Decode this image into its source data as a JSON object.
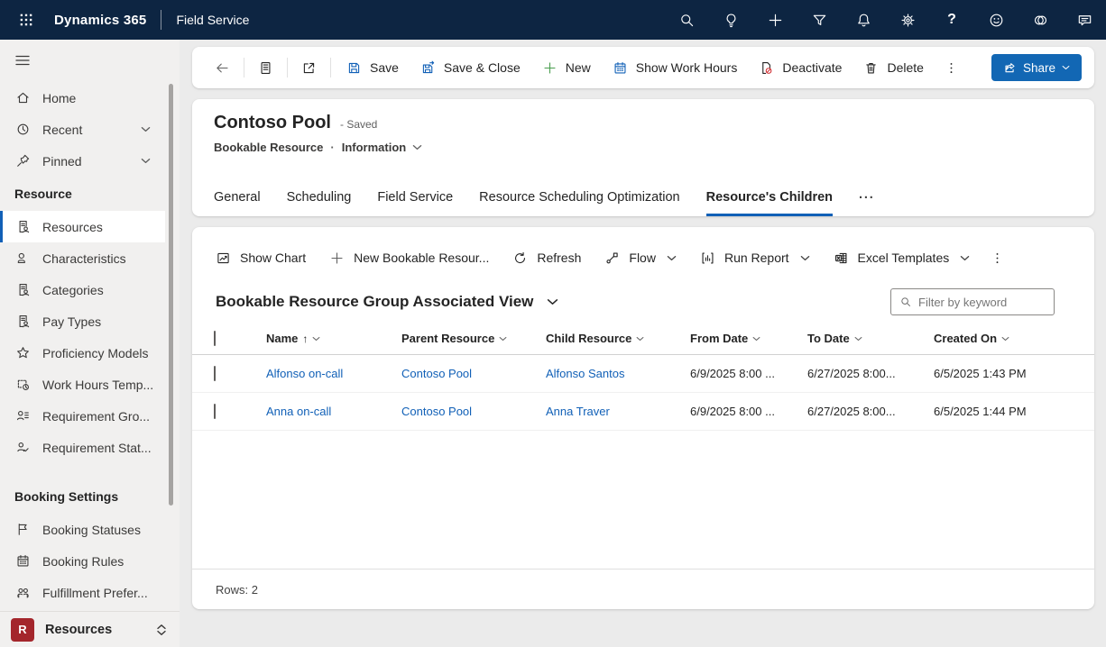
{
  "colors": {
    "topbar_bg": "#0d2542",
    "accent_blue": "#1160b7",
    "link_blue": "#1160b7",
    "share_button_bg": "#1267b4",
    "new_green": "#4a9e4f",
    "deactivate_red": "#d13438",
    "app_tile_red": "#a4262c",
    "sidebar_bg": "#f1f0ef",
    "workspace_bg": "#ebebeb"
  },
  "topbar": {
    "app_name": "Dynamics 365",
    "area_name": "Field Service"
  },
  "sidebar": {
    "nav": [
      {
        "label": "Home"
      },
      {
        "label": "Recent"
      },
      {
        "label": "Pinned"
      }
    ],
    "resource_section": "Resource",
    "resource_items": [
      "Resources",
      "Characteristics",
      "Categories",
      "Pay Types",
      "Proficiency Models",
      "Work Hours Temp...",
      "Requirement Gro...",
      "Requirement Stat..."
    ],
    "booking_section": "Booking Settings",
    "booking_items": [
      "Booking Statuses",
      "Booking Rules",
      "Fulfillment Prefer..."
    ],
    "footer": {
      "initial": "R",
      "label": "Resources"
    }
  },
  "commands": {
    "save": "Save",
    "save_close": "Save & Close",
    "new_label": "New",
    "show_work_hours": "Show Work Hours",
    "deactivate": "Deactivate",
    "delete": "Delete",
    "share": "Share"
  },
  "record": {
    "title": "Contoso Pool",
    "status": "- Saved",
    "entity": "Bookable Resource",
    "separator": "·",
    "form": "Information"
  },
  "tabs": {
    "items": [
      "General",
      "Scheduling",
      "Field Service",
      "Resource Scheduling Optimization",
      "Resource's Children"
    ],
    "active": "Resource's Children",
    "overflow": "···"
  },
  "grid_commands": {
    "show_chart": "Show Chart",
    "new_record": "New Bookable Resour...",
    "refresh": "Refresh",
    "flow": "Flow",
    "run_report": "Run Report",
    "excel_templates": "Excel Templates"
  },
  "view": {
    "title": "Bookable Resource Group Associated View",
    "filter_placeholder": "Filter by keyword",
    "rows_label": "Rows: 2"
  },
  "table": {
    "columns": [
      "Name",
      "Parent Resource",
      "Child Resource",
      "From Date",
      "To Date",
      "Created On"
    ],
    "sorted_by": "Name ascending",
    "sort_arrow": "↑",
    "rows": [
      {
        "name": "Alfonso on-call",
        "parent_resource": "Contoso Pool",
        "child_resource": "Alfonso Santos",
        "from_date": "6/9/2025 8:00 ...",
        "to_date": "6/27/2025 8:00...",
        "created_on": "6/5/2025 1:43 PM"
      },
      {
        "name": "Anna on-call",
        "parent_resource": "Contoso Pool",
        "child_resource": "Anna Traver",
        "from_date": "6/9/2025 8:00 ...",
        "to_date": "6/27/2025 8:00...",
        "created_on": "6/5/2025 1:44 PM"
      }
    ]
  },
  "icons": {
    "topbar": [
      "waffle-icon",
      "search-icon",
      "lightbulb-icon",
      "add-icon",
      "filter-icon",
      "bell-icon",
      "gear-icon",
      "help-icon",
      "smiley-icon",
      "copilot-icon",
      "chat-icon"
    ],
    "sidebar": [
      "hamburger-icon",
      "home-icon",
      "clock-icon",
      "pin-icon",
      "resource-doc-icon",
      "person-icon",
      "star-icon",
      "calendar-clock-icon",
      "person-list-icon",
      "person-check-icon",
      "flag-icon",
      "calendar-icon",
      "people-sync-icon",
      "chevron-down-icon",
      "chevron-updown-icon"
    ],
    "commands": [
      "back-arrow-icon",
      "form-icon",
      "popout-icon",
      "save-icon",
      "save-close-icon",
      "plus-icon",
      "calendar-icon",
      "deactivate-icon",
      "trash-icon",
      "more-vertical-icon",
      "share-icon"
    ],
    "grid": [
      "chart-icon",
      "plus-icon",
      "refresh-icon",
      "flow-icon",
      "report-icon",
      "excel-icon",
      "more-vertical-icon",
      "search-icon",
      "checkbox"
    ]
  }
}
